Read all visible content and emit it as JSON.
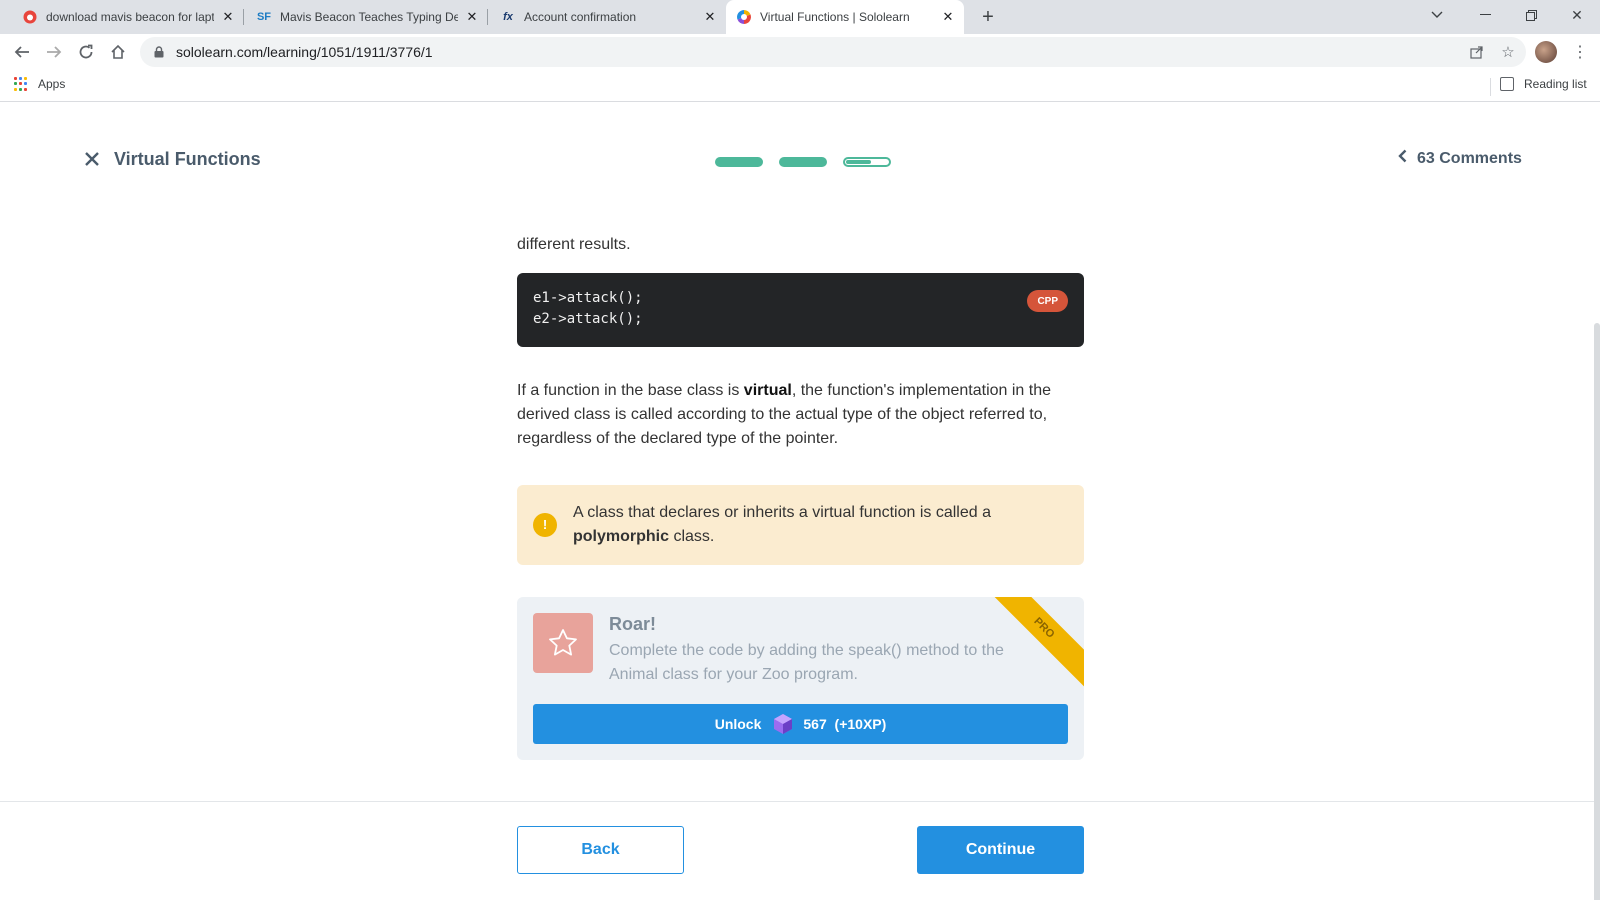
{
  "browser": {
    "tabs": [
      {
        "title": "download mavis beacon for lapto",
        "favicon": "red-circle-icon",
        "active": false
      },
      {
        "title": "Mavis Beacon Teaches Typing De",
        "favicon": "SF",
        "active": false
      },
      {
        "title": "Account confirmation",
        "favicon": "fx",
        "active": false
      },
      {
        "title": "Virtual Functions | Sololearn",
        "favicon": "sololearn-logo-icon",
        "active": true
      }
    ],
    "url": "sololearn.com/learning/1051/1911/3776/1",
    "bookmarks": {
      "apps_label": "Apps",
      "reading_list_label": "Reading list"
    }
  },
  "lesson": {
    "title": "Virtual Functions",
    "progress": {
      "total": 3,
      "completed": 2,
      "current_fill": 0.6
    },
    "comments_label": "63 Comments"
  },
  "content": {
    "lead_tail": "different results.",
    "code": {
      "language": "CPP",
      "lines": [
        "e1->attack();",
        "e2->attack();"
      ]
    },
    "paragraph": {
      "pre": "If a function in the base class is ",
      "bold": "virtual",
      "post": ", the function's implementation in the derived class is called according to the actual type of the object referred to, regardless of the declared type of the pointer."
    },
    "note": {
      "pre": "A class that declares or inherits a virtual function is called a ",
      "bold": "polymorphic",
      "post": " class."
    },
    "pro_card": {
      "title": "Roar!",
      "description": "Complete the code by adding the speak() method to the Animal class for your Zoo program.",
      "ribbon": "PRO",
      "unlock_label": "Unlock",
      "unlock_cost": "567",
      "unlock_xp": "(+10XP)"
    }
  },
  "footer": {
    "back_label": "Back",
    "continue_label": "Continue"
  },
  "colors": {
    "accent": "#2390e0",
    "progress": "#4db89a",
    "code_bg": "#232527",
    "lang_badge": "#d5553a",
    "note_bg": "#fbecd0",
    "ribbon": "#f0b400"
  }
}
